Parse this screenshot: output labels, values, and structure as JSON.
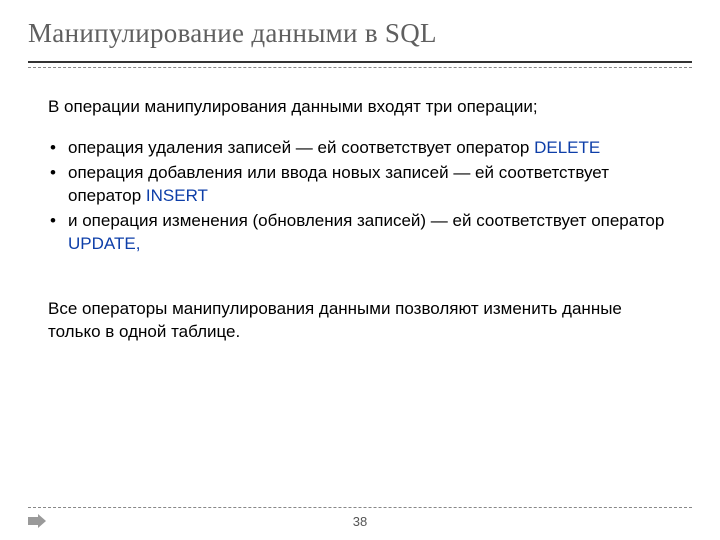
{
  "title": "Манипулирование данными в  SQL",
  "intro": "В операции манипулирования данными входят три операции;",
  "bullets": [
    {
      "pre": "операция удаления записей — ей соответствует оператор ",
      "kw": "DELETE",
      "post": ""
    },
    {
      "pre": "операция добавления или ввода новых записей — ей соответствует оператор ",
      "kw": "INSERT",
      "post": ""
    },
    {
      "pre": " и операция изменения (обновления записей) — ей соответствует оператор ",
      "kw": "UPDATE,",
      "post": ""
    }
  ],
  "footnote": "Все операторы манипулирования данными позволяют изменить данные только в одной таблице.",
  "page_number": "38"
}
